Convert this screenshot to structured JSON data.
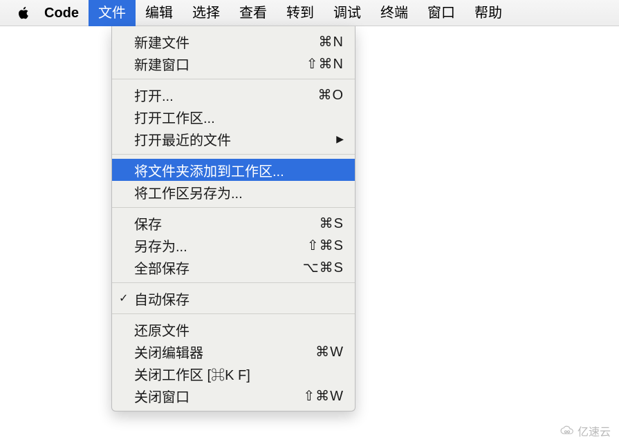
{
  "menubar": {
    "app_name": "Code",
    "items": [
      "文件",
      "编辑",
      "选择",
      "查看",
      "转到",
      "调试",
      "终端",
      "窗口",
      "帮助"
    ],
    "active_index": 0
  },
  "dropdown": {
    "groups": [
      [
        {
          "label": "新建文件",
          "shortcut": "⌘N"
        },
        {
          "label": "新建窗口",
          "shortcut": "⇧⌘N"
        }
      ],
      [
        {
          "label": "打开...",
          "shortcut": "⌘O"
        },
        {
          "label": "打开工作区..."
        },
        {
          "label": "打开最近的文件",
          "submenu": true
        }
      ],
      [
        {
          "label": "将文件夹添加到工作区...",
          "highlighted": true
        },
        {
          "label": "将工作区另存为..."
        }
      ],
      [
        {
          "label": "保存",
          "shortcut": "⌘S"
        },
        {
          "label": "另存为...",
          "shortcut": "⇧⌘S"
        },
        {
          "label": "全部保存",
          "shortcut": "⌥⌘S"
        }
      ],
      [
        {
          "label": "自动保存",
          "checked": true
        }
      ],
      [
        {
          "label": "还原文件"
        },
        {
          "label": "关闭编辑器",
          "shortcut": "⌘W"
        },
        {
          "label": "关闭工作区 [⌘K F]"
        },
        {
          "label": "关闭窗口",
          "shortcut": "⇧⌘W"
        }
      ]
    ]
  },
  "watermark": {
    "text": "亿速云"
  }
}
